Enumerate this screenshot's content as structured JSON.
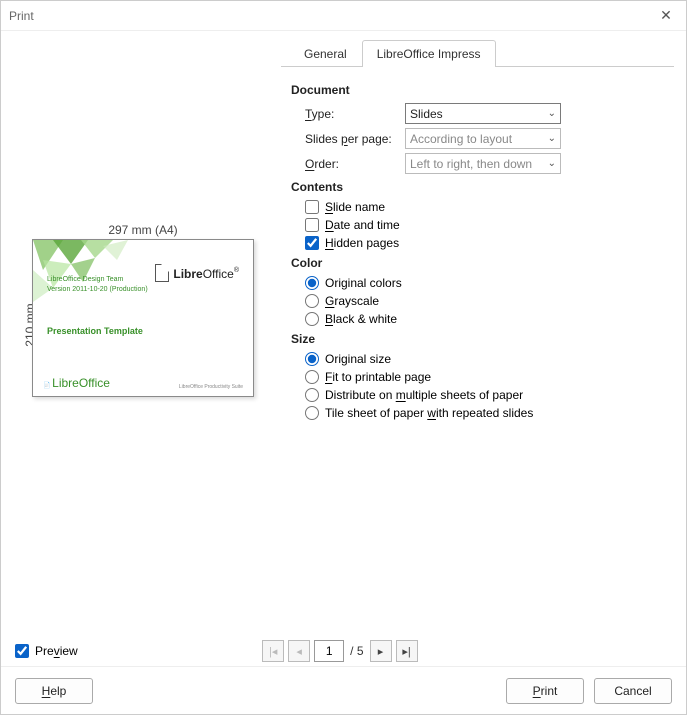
{
  "window": {
    "title": "Print"
  },
  "preview": {
    "dim_top": "297 mm (A4)",
    "dim_left": "210 mm",
    "slide": {
      "line1": "LibreOffice Design Team",
      "line2": "Version 2011-10-20 (Production)",
      "title": "Presentation Template",
      "footer_left": "LibreOffice",
      "footer_right": "LibreOffice Productivity Suite",
      "logo_text_a": "Libre",
      "logo_text_b": "Office"
    }
  },
  "tabs": {
    "general": "General",
    "impress": "LibreOffice Impress"
  },
  "document": {
    "head": "Document",
    "type_lbl": "Type:",
    "type_val": "Slides",
    "spp_lbl": "Slides per page:",
    "spp_val": "According to layout",
    "order_lbl": "Order:",
    "order_val": "Left to right, then down"
  },
  "contents": {
    "head": "Contents",
    "slide_name": "Slide name",
    "date_time": "Date and time",
    "hidden_pages": "Hidden pages"
  },
  "color": {
    "head": "Color",
    "original": "Original colors",
    "grayscale": "Grayscale",
    "bw": "Black & white"
  },
  "size": {
    "head": "Size",
    "original": "Original size",
    "fit": "Fit to printable page",
    "distribute": "Distribute on multiple sheets of paper",
    "tile": "Tile sheet of paper with repeated slides"
  },
  "bottom": {
    "preview_label": "Preview",
    "page_current": "1",
    "page_total": "/ 5"
  },
  "footer": {
    "help": "Help",
    "print": "Print",
    "cancel": "Cancel"
  }
}
